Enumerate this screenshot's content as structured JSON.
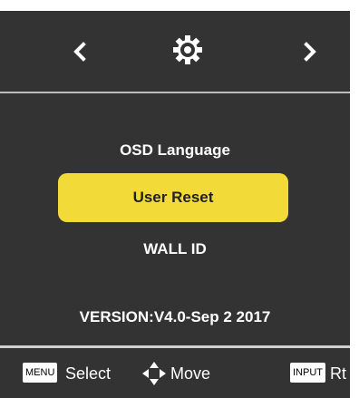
{
  "header": {
    "left_arrow_icon": "chevron-left-icon",
    "settings_icon": "gear-icon",
    "right_arrow_icon": "chevron-right-icon"
  },
  "menu": {
    "items": [
      {
        "label": "OSD Language",
        "selected": false
      },
      {
        "label": "User Reset",
        "selected": true
      },
      {
        "label": "WALL ID",
        "selected": false
      }
    ],
    "version": "VERSION:V4.0-Sep  2 2017"
  },
  "footer": {
    "menu_key": "MENU",
    "menu_action": "Select",
    "move_icon": "four-way-arrow-icon",
    "move_action": "Move",
    "input_key": "INPUT",
    "input_action": "Rt"
  },
  "colors": {
    "panel_background": "#333333",
    "highlight": "#f2db38",
    "divider": "#bdbdbd"
  }
}
